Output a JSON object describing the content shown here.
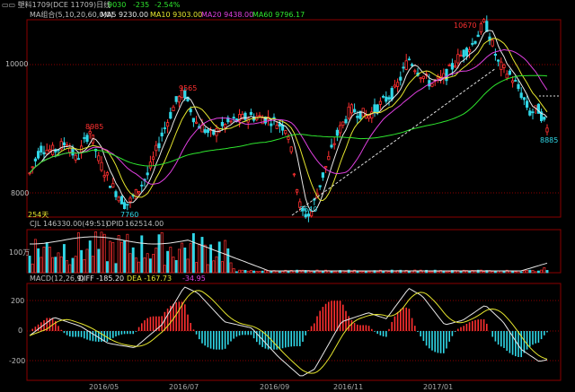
{
  "header": {
    "icon_text": "▭▭",
    "title": "塑料1709(DCE 11709)日线",
    "price": "9030",
    "change": "-235",
    "change_pct": "-2.54%"
  },
  "ma_legend": {
    "label": "MA组合(5,10,20,60,0,0)",
    "ma5": "MA5 9230.00",
    "ma10": "MA10 9303.00",
    "ma20": "MA20 9438.00",
    "ma60": "MA60 9796.17"
  },
  "price_panel": {
    "axis_labels": [
      "10000",
      "8000"
    ],
    "annotations": {
      "high_peak": "10670",
      "peak_9565": "9565",
      "peak_8985": "8985",
      "low_7760": "7760",
      "low_7640": "7640",
      "last_8885": "8885",
      "days": "254天"
    }
  },
  "volume_panel": {
    "label": "CJL",
    "cjl": "146330.00(49:51)",
    "opid_label": "OPID",
    "opid": "162514.00",
    "axis_label": "100万"
  },
  "macd_panel": {
    "label": "MACD(12,26,9)",
    "diff": "DIFF -185.20",
    "dea": "DEA -167.73",
    "macd": "-34.95",
    "axis_labels": [
      "200",
      "0",
      "-200"
    ]
  },
  "x_axis": {
    "labels": [
      "2016/05",
      "2016/07",
      "2016/09",
      "2016/11",
      "2017/01"
    ]
  },
  "colors": {
    "up": "#ff3030",
    "down": "#30d8e8",
    "ma5": "#e8e8e8",
    "ma10": "#e6e62e",
    "ma20": "#e040e0",
    "ma60": "#2ee62e",
    "grid": "#8b0000"
  }
}
